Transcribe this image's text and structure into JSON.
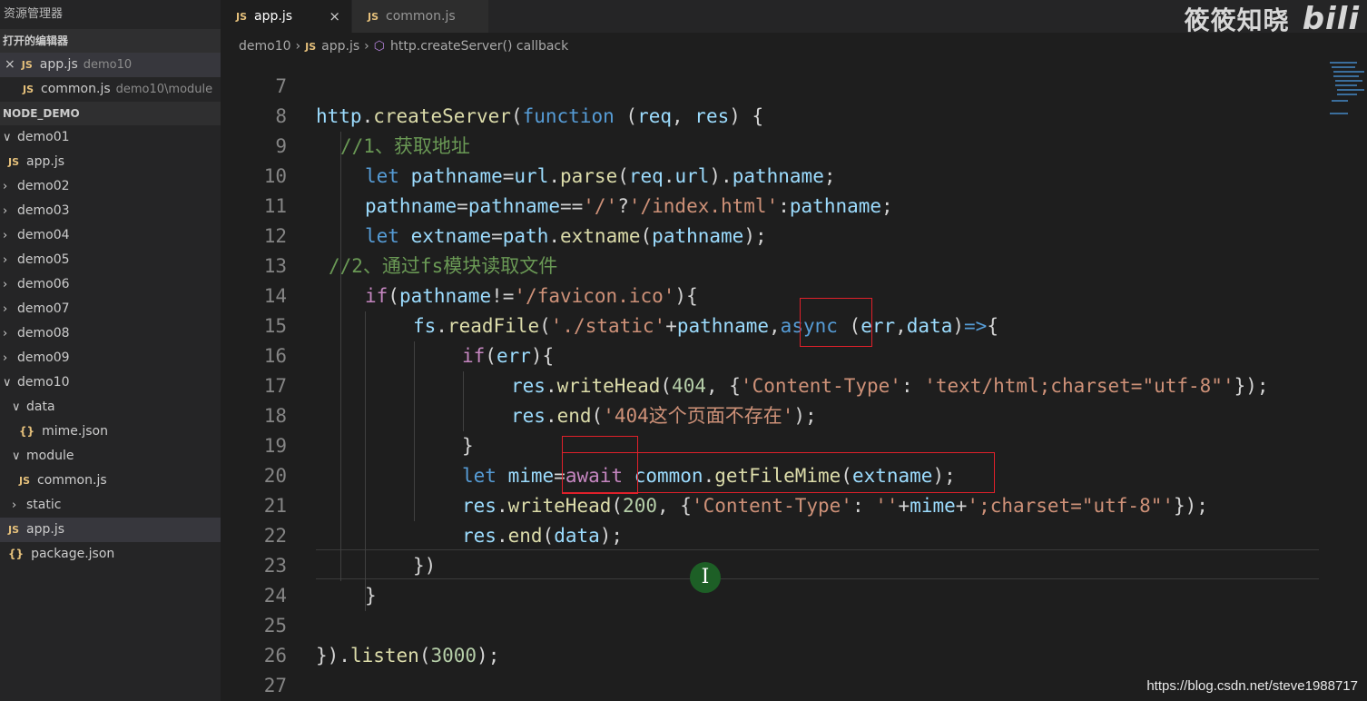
{
  "sidebar": {
    "title": "资源管理器",
    "open_editors_label": "打开的编辑器",
    "open_editors": [
      {
        "close": "×",
        "icon": "JS",
        "name": "app.js",
        "desc": "demo10"
      },
      {
        "close": "",
        "icon": "JS",
        "name": "common.js",
        "desc": "demo10\\module"
      }
    ],
    "project_label": "NODE_DEMO",
    "tree": [
      {
        "chev": "∨",
        "icon": "",
        "label": "demo01"
      },
      {
        "chev": "",
        "icon": "JS",
        "label": "app.js"
      },
      {
        "chev": "›",
        "icon": "",
        "label": "demo02"
      },
      {
        "chev": "›",
        "icon": "",
        "label": "demo03"
      },
      {
        "chev": "›",
        "icon": "",
        "label": "demo04"
      },
      {
        "chev": "›",
        "icon": "",
        "label": "demo05"
      },
      {
        "chev": "›",
        "icon": "",
        "label": "demo06"
      },
      {
        "chev": "›",
        "icon": "",
        "label": "demo07"
      },
      {
        "chev": "›",
        "icon": "",
        "label": "demo08"
      },
      {
        "chev": "›",
        "icon": "",
        "label": "demo09"
      },
      {
        "chev": "∨",
        "icon": "",
        "label": "demo10"
      },
      {
        "chev": "∨",
        "icon": "",
        "label": "data"
      },
      {
        "chev": "",
        "icon": "{}",
        "label": "mime.json"
      },
      {
        "chev": "∨",
        "icon": "",
        "label": "module"
      },
      {
        "chev": "",
        "icon": "JS",
        "label": "common.js"
      },
      {
        "chev": "›",
        "icon": "",
        "label": "static"
      },
      {
        "chev": "",
        "icon": "JS",
        "label": "app.js"
      },
      {
        "chev": "",
        "icon": "{}",
        "label": "package.json"
      }
    ]
  },
  "tabs": [
    {
      "icon": "JS",
      "label": "app.js",
      "close": "×"
    },
    {
      "icon": "JS",
      "label": "common.js",
      "close": ""
    }
  ],
  "breadcrumb": {
    "folder": "demo10",
    "file_icon": "JS",
    "file": "app.js",
    "symbol": "http.createServer() callback"
  },
  "watermark": {
    "text": "筱筱知晓",
    "logo": "bili"
  },
  "editor": {
    "lines": [
      {
        "num": "7"
      },
      {
        "num": "8"
      },
      {
        "num": "9"
      },
      {
        "num": "10"
      },
      {
        "num": "11"
      },
      {
        "num": "12"
      },
      {
        "num": "13"
      },
      {
        "num": "14"
      },
      {
        "num": "15"
      },
      {
        "num": "16"
      },
      {
        "num": "17"
      },
      {
        "num": "18"
      },
      {
        "num": "19"
      },
      {
        "num": "20"
      },
      {
        "num": "21"
      },
      {
        "num": "22"
      },
      {
        "num": "23"
      },
      {
        "num": "24"
      },
      {
        "num": "25"
      },
      {
        "num": "26"
      },
      {
        "num": "27"
      }
    ],
    "code": {
      "l8": [
        "http",
        ".",
        "createServer",
        "(",
        "function",
        " (",
        "req",
        ", ",
        "res",
        ") {"
      ],
      "l9": [
        "//1、获取地址"
      ],
      "l10": [
        "let",
        " ",
        "pathname",
        "=",
        "url",
        ".",
        "parse",
        "(",
        "req",
        ".",
        "url",
        ").",
        "pathname",
        ";"
      ],
      "l11": [
        "pathname",
        "=",
        "pathname",
        "==",
        "'/'",
        "?",
        "'/index.html'",
        ":",
        "pathname",
        ";"
      ],
      "l12": [
        "let",
        " ",
        "extname",
        "=",
        "path",
        ".",
        "extname",
        "(",
        "pathname",
        ");"
      ],
      "l13": [
        "//2、通过fs模块读取文件"
      ],
      "l14": [
        "if",
        "(",
        "pathname",
        "!=",
        "'/favicon.ico'",
        "){"
      ],
      "l15": [
        "fs",
        ".",
        "readFile",
        "(",
        "'./static'",
        "+",
        "pathname",
        ",",
        "async",
        " (",
        "err",
        ",",
        "data",
        ")",
        "=>",
        "{"
      ],
      "l16": [
        "if",
        "(",
        "err",
        "){"
      ],
      "l17": [
        "res",
        ".",
        "writeHead",
        "(",
        "404",
        ", {",
        "'Content-Type'",
        ": ",
        "'text/html;charset=\"utf-8\"'",
        "});"
      ],
      "l18": [
        "res",
        ".",
        "end",
        "(",
        "'404这个页面不存在'",
        ");"
      ],
      "l19": [
        "}"
      ],
      "l20": [
        "let",
        " ",
        "mime",
        "=",
        "await",
        " ",
        "common",
        ".",
        "getFileMime",
        "(",
        "extname",
        ");"
      ],
      "l21": [
        "res",
        ".",
        "writeHead",
        "(",
        "200",
        ", {",
        "'Content-Type'",
        ": ",
        "''",
        "+",
        "mime",
        "+",
        "';charset=\"utf-8\"'",
        "});"
      ],
      "l22": [
        "res",
        ".",
        "end",
        "(",
        "data",
        ");"
      ],
      "l23": [
        "})"
      ],
      "l24": [
        "}"
      ],
      "l26": [
        "})",
        ".",
        "listen",
        "(",
        "3000",
        ");"
      ]
    }
  },
  "cursor_glyph": "I",
  "footer_url": "https://blog.csdn.net/steve1988717"
}
